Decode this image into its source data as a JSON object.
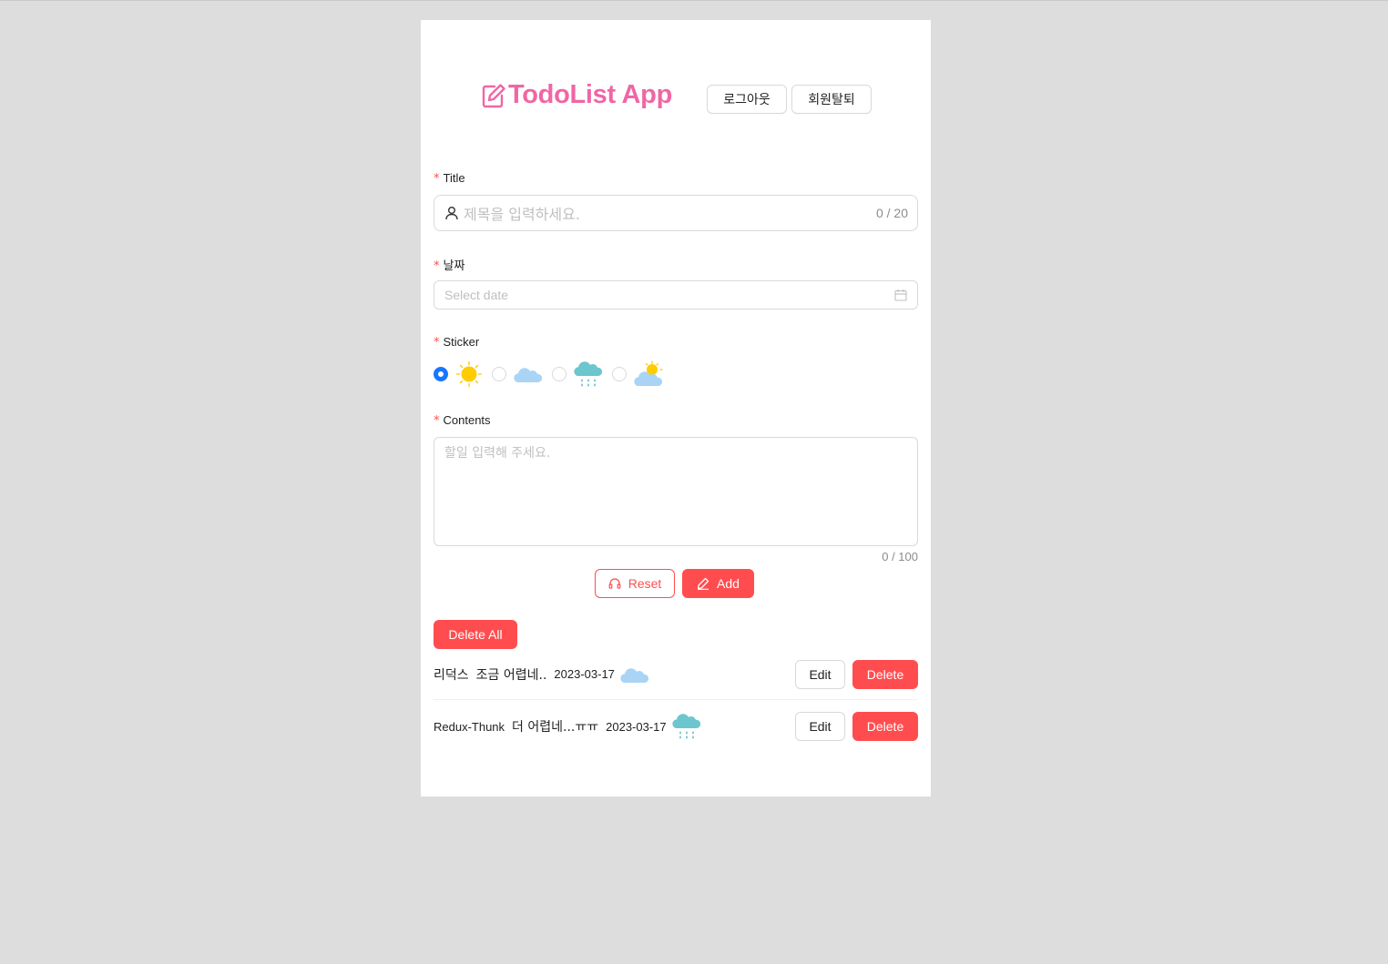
{
  "header": {
    "app_title": "TodoList App",
    "logout_label": "로그아웃",
    "withdraw_label": "회원탈퇴",
    "brand_color": "#f066a5"
  },
  "form": {
    "required_mark": "*",
    "title_label": "Title",
    "title_placeholder": "제목을 입력하세요.",
    "title_count": "0 / 20",
    "date_label": "날짜",
    "date_placeholder": "Select date",
    "sticker_label": "Sticker",
    "stickers": [
      {
        "icon": "sun-icon",
        "selected": true
      },
      {
        "icon": "cloud-icon",
        "selected": false
      },
      {
        "icon": "rain-cloud-icon",
        "selected": false
      },
      {
        "icon": "partly-cloudy-icon",
        "selected": false
      }
    ],
    "contents_label": "Contents",
    "contents_placeholder": "할일 입력해 주세요.",
    "contents_count": "0 / 100",
    "reset_label": "Reset",
    "add_label": "Add"
  },
  "list": {
    "delete_all_label": "Delete All",
    "items": [
      {
        "title": "리덕스",
        "text": "조금 어렵네..",
        "date": "2023-03-17",
        "sticker": "cloud-icon",
        "edit_label": "Edit",
        "delete_label": "Delete"
      },
      {
        "title": "Redux-Thunk",
        "text": "더 어렵네...ㅠㅠ",
        "date": "2023-03-17",
        "sticker": "rain-cloud-icon",
        "edit_label": "Edit",
        "delete_label": "Delete"
      }
    ]
  },
  "colors": {
    "primary_danger": "#ff4d4f",
    "radio_checked": "#1677ff",
    "background": "#dddddd"
  }
}
